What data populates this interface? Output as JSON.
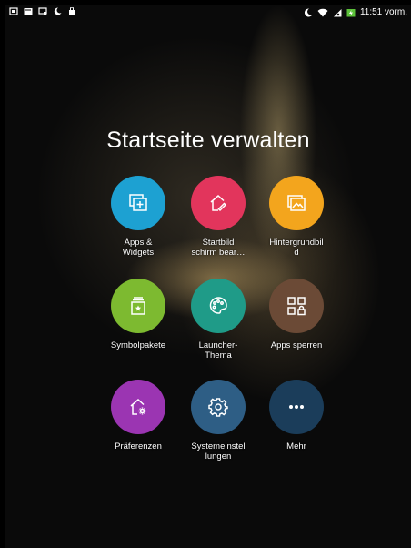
{
  "status_bar": {
    "time": "11:51 vorm."
  },
  "title": "Startseite verwalten",
  "items": [
    {
      "label": "Apps &\nWidgets",
      "icon": "apps-widgets-icon",
      "color": "#1da1d2"
    },
    {
      "label": "Startbild\nschirm bear…",
      "icon": "edit-home-icon",
      "color": "#e2355c"
    },
    {
      "label": "Hintergrundbil\nd",
      "icon": "wallpaper-icon",
      "color": "#f3a51d"
    },
    {
      "label": "Symbolpakete",
      "icon": "icon-pack-icon",
      "color": "#7dba30"
    },
    {
      "label": "Launcher-\nThema",
      "icon": "palette-icon",
      "color": "#1f9b88"
    },
    {
      "label": "Apps sperren",
      "icon": "app-lock-icon",
      "color": "#6b4a36"
    },
    {
      "label": "Präferenzen",
      "icon": "preferences-icon",
      "color": "#9b35b2"
    },
    {
      "label": "Systemeinstel\nlungen",
      "icon": "system-settings-icon",
      "color": "#2e5e85"
    },
    {
      "label": "Mehr",
      "icon": "more-icon",
      "color": "#1b3d5a"
    }
  ]
}
